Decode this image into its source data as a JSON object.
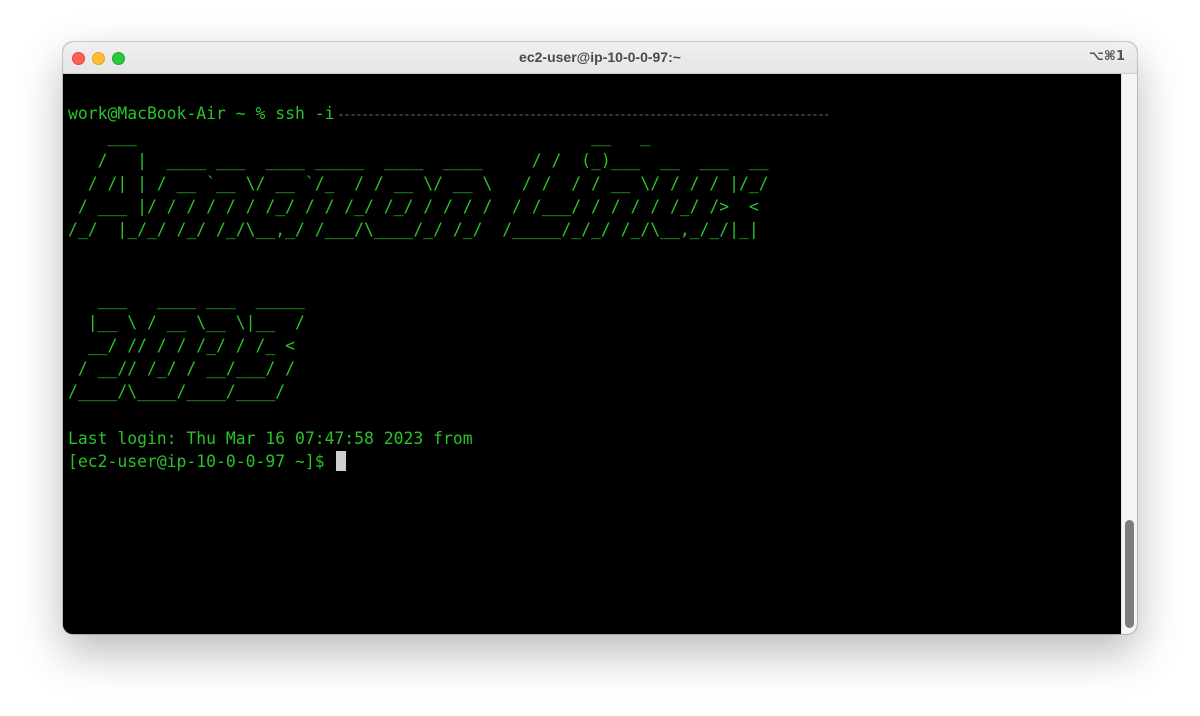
{
  "window": {
    "title": "ec2-user@ip-10-0-0-97:~",
    "shortcut": "⌥⌘1"
  },
  "terminal": {
    "command_prompt": "work@MacBook-Air ~ % ssh -i",
    "banner_amazon_linux": [
      "    ___                                              __   _",
      "   /   |  ____ ___  ____ _____  ____  ____     / /  (_)___  __  ___  __",
      "  / /| | / __ `__ \\/ __ `/_  / / __ \\/ __ \\   / /  / / __ \\/ / / / |/_/",
      " / ___ |/ / / / / / /_/ / / /_/ /_/ / / / /  / /___/ / / / / /_/ />  <",
      "/_/  |_/_/ /_/ /_/\\__,_/ /___/\\____/_/ /_/  /_____/_/_/ /_/\\__,_/_/|_|"
    ],
    "banner_2023": [
      "   ___   ____ ___  _____",
      "  |__ \\ / __ \\__ \\|__  /",
      "  __/ // / / /_/ / /_ <",
      " / __// /_/ / __/___/ /",
      "/____/\\____/____/____/"
    ],
    "last_login": "Last login: Thu Mar 16 07:47:58 2023 from",
    "shell_prompt": "[ec2-user@ip-10-0-0-97 ~]$"
  },
  "colors": {
    "terminal_text": "#29c229",
    "terminal_background": "#000000",
    "cursor": "#cfcfcf"
  }
}
